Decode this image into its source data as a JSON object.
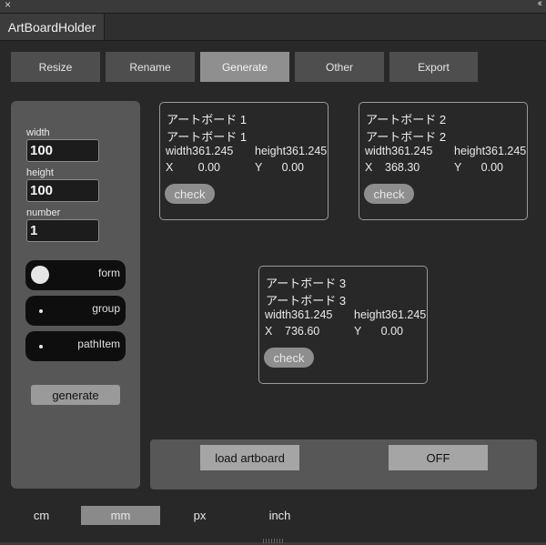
{
  "window": {
    "close_glyph": "×",
    "collapse_glyph": "‹‹",
    "panel_tab": "ArtBoardHolder"
  },
  "nav": {
    "items": [
      {
        "label": "Resize",
        "active": false
      },
      {
        "label": "Rename",
        "active": false
      },
      {
        "label": "Generate",
        "active": true
      },
      {
        "label": "Other",
        "active": false
      },
      {
        "label": "Export",
        "active": false
      }
    ]
  },
  "side": {
    "width_label": "width",
    "width_value": "100",
    "height_label": "height",
    "height_value": "100",
    "number_label": "number",
    "number_value": "1",
    "options": [
      {
        "label": "form",
        "selected": true
      },
      {
        "label": "group",
        "selected": false
      },
      {
        "label": "pathItem",
        "selected": false
      }
    ],
    "generate_label": "generate"
  },
  "artboards": [
    {
      "name1": "アートボード 1",
      "name2": "アートボード 1",
      "width": "width361.245",
      "height": "height361.245",
      "x_label": "X",
      "x_value": "0.00",
      "y_label": "Y",
      "y_value": "0.00",
      "check": "check"
    },
    {
      "name1": "アートボード 2",
      "name2": "アートボード 2",
      "width": "width361.245",
      "height": "height361.245",
      "x_label": "X",
      "x_value": "368.30",
      "y_label": "Y",
      "y_value": "0.00",
      "check": "check"
    },
    {
      "name1": "アートボード 3",
      "name2": "アートボード 3",
      "width": "width361.245",
      "height": "height361.245",
      "x_label": "X",
      "x_value": "736.60",
      "y_label": "Y",
      "y_value": "0.00",
      "check": "check"
    }
  ],
  "bottom": {
    "load_label": "load artboard",
    "off_label": "OFF"
  },
  "units": {
    "items": [
      {
        "label": "cm",
        "active": false
      },
      {
        "label": "mm",
        "active": true
      },
      {
        "label": "px",
        "active": false
      },
      {
        "label": "inch",
        "active": false
      }
    ]
  },
  "colors": {
    "background": "#282828",
    "panel": "#575757",
    "active_tab": "#8f8f8f",
    "inactive_tab": "#4e4e4e"
  }
}
